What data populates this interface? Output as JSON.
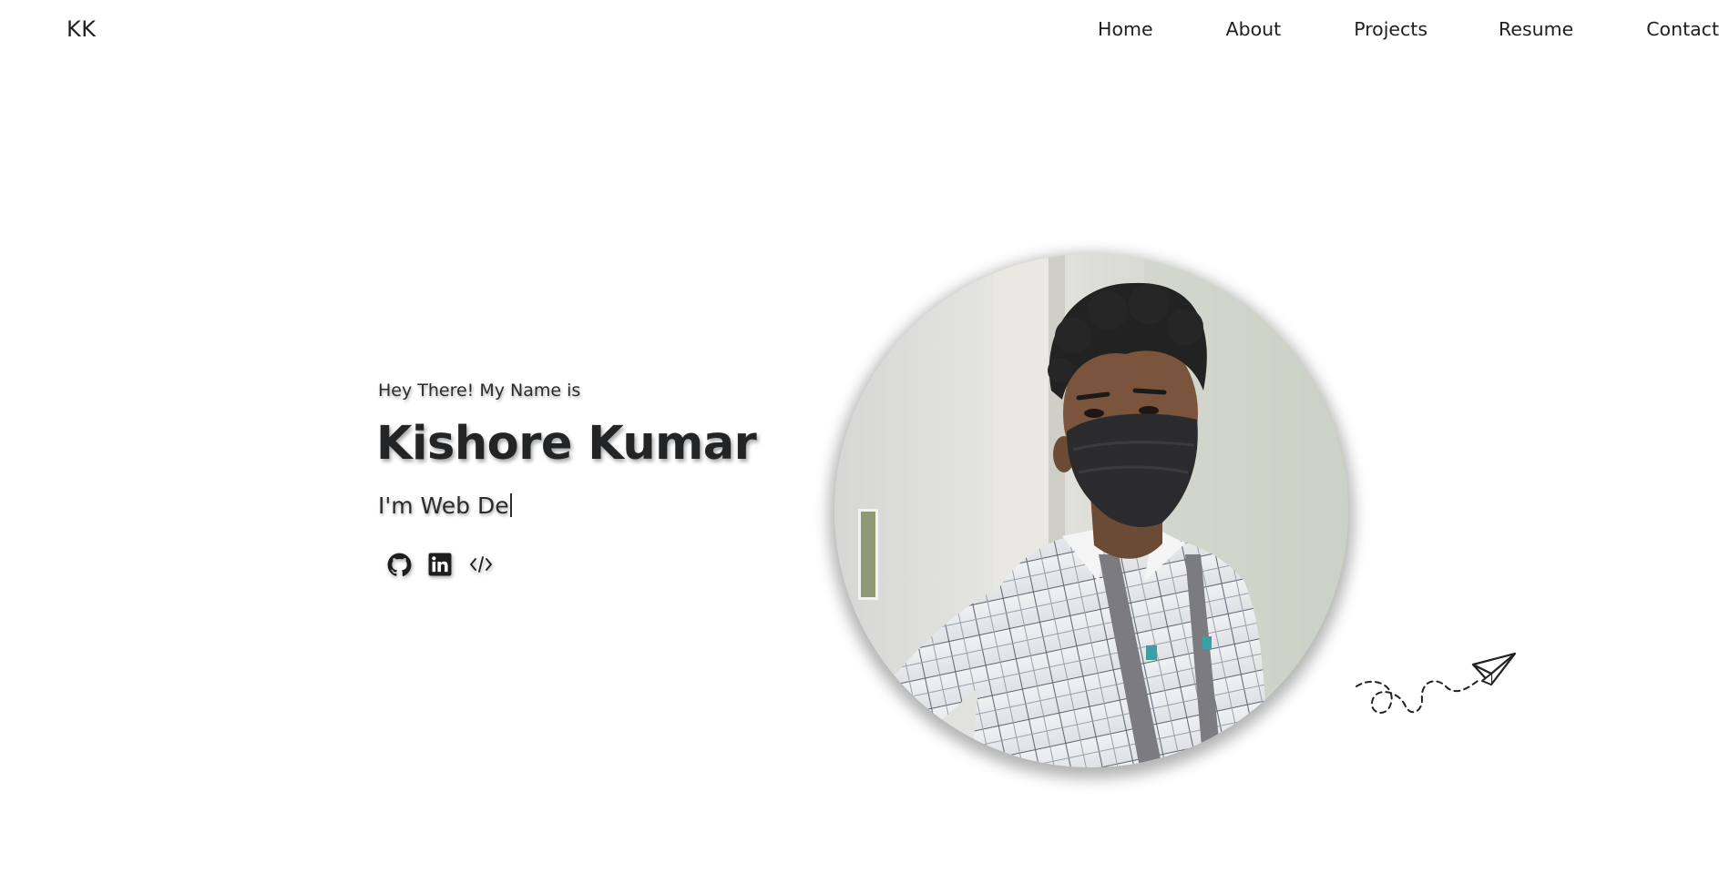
{
  "brand": {
    "logo_text": "KK"
  },
  "nav": {
    "items": [
      {
        "label": "Home"
      },
      {
        "label": "About"
      },
      {
        "label": "Projects"
      },
      {
        "label": "Resume"
      },
      {
        "label": "Contact"
      }
    ]
  },
  "hero": {
    "greeting": "Hey There! My Name is",
    "name": "Kishore Kumar",
    "role_typed": "I'm Web De"
  },
  "socials": [
    {
      "icon": "github-icon"
    },
    {
      "icon": "linkedin-icon"
    },
    {
      "icon": "code-icon"
    }
  ],
  "colors": {
    "text": "#222426",
    "background": "#ffffff"
  }
}
